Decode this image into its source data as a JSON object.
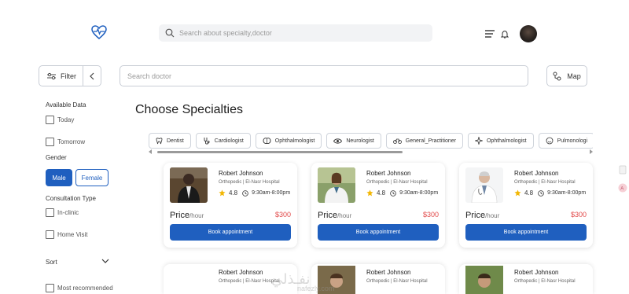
{
  "header": {
    "search_placeholder": "Search about specialty,doctor"
  },
  "filterbar": {
    "filter_label": "Filter",
    "doctor_search_placeholder": "Search doctor",
    "map_label": "Map"
  },
  "sidebar": {
    "available_title": "Available Data",
    "today": "Today",
    "tomorrow": "Tomorrow",
    "gender_title": "Gender",
    "male": "Male",
    "female": "Female",
    "consultation_title": "Consultation Type",
    "in_clinic": "In-clinic",
    "home_visit": "Home Visit",
    "sort_title": "Sort",
    "most_recommended": "Most recommended"
  },
  "main": {
    "title": "Choose Specialties",
    "chips": [
      {
        "label": "Dentist",
        "icon": "tooth-icon"
      },
      {
        "label": "Cardiologist",
        "icon": "stethoscope-icon"
      },
      {
        "label": "Ophthalmologist",
        "icon": "brain-icon"
      },
      {
        "label": "Neurologist",
        "icon": "eye-icon"
      },
      {
        "label": "General_Practitioner",
        "icon": "bike-icon"
      },
      {
        "label": "Ophthalmologist",
        "icon": "sparkle-icon"
      },
      {
        "label": "Pulmonologi",
        "icon": "smile-icon"
      }
    ]
  },
  "cards": [
    {
      "name": "Robert Johnson",
      "specialty": "Orthopedic | El-Nasr Hospital",
      "rating": "4.8",
      "hours": "9:30am-8:00pm",
      "price_label": "Price",
      "price_unit": "/hour",
      "price": "$300",
      "book": "Book appointment"
    },
    {
      "name": "Robert Johnson",
      "specialty": "Orthopedic | El-Nasr Hospital",
      "rating": "4.8",
      "hours": "9:30am-8:00pm",
      "price_label": "Price",
      "price_unit": "/hour",
      "price": "$300",
      "book": "Book appointment"
    },
    {
      "name": "Robert Johnson",
      "specialty": "Orthopedic | El-Nasr Hospital",
      "rating": "4.8",
      "hours": "9:30am-8:00pm",
      "price_label": "Price",
      "price_unit": "/hour",
      "price": "$300",
      "book": "Book appointment"
    }
  ],
  "cards_row2": [
    {
      "name": "Robert Johnson",
      "specialty": "Orthopedic | El-Nasr Hospital"
    },
    {
      "name": "Robert Johnson",
      "specialty": "Orthopedic | El-Nasr Hospital"
    },
    {
      "name": "Robert Johnson",
      "specialty": "Orthopedic | El-Nasr Hospital"
    }
  ],
  "watermark": {
    "text": "نفـذلي",
    "sub": "nafezly.com"
  },
  "colors": {
    "primary": "#1f5fbf",
    "price": "#e14848",
    "star": "#f2b705"
  }
}
